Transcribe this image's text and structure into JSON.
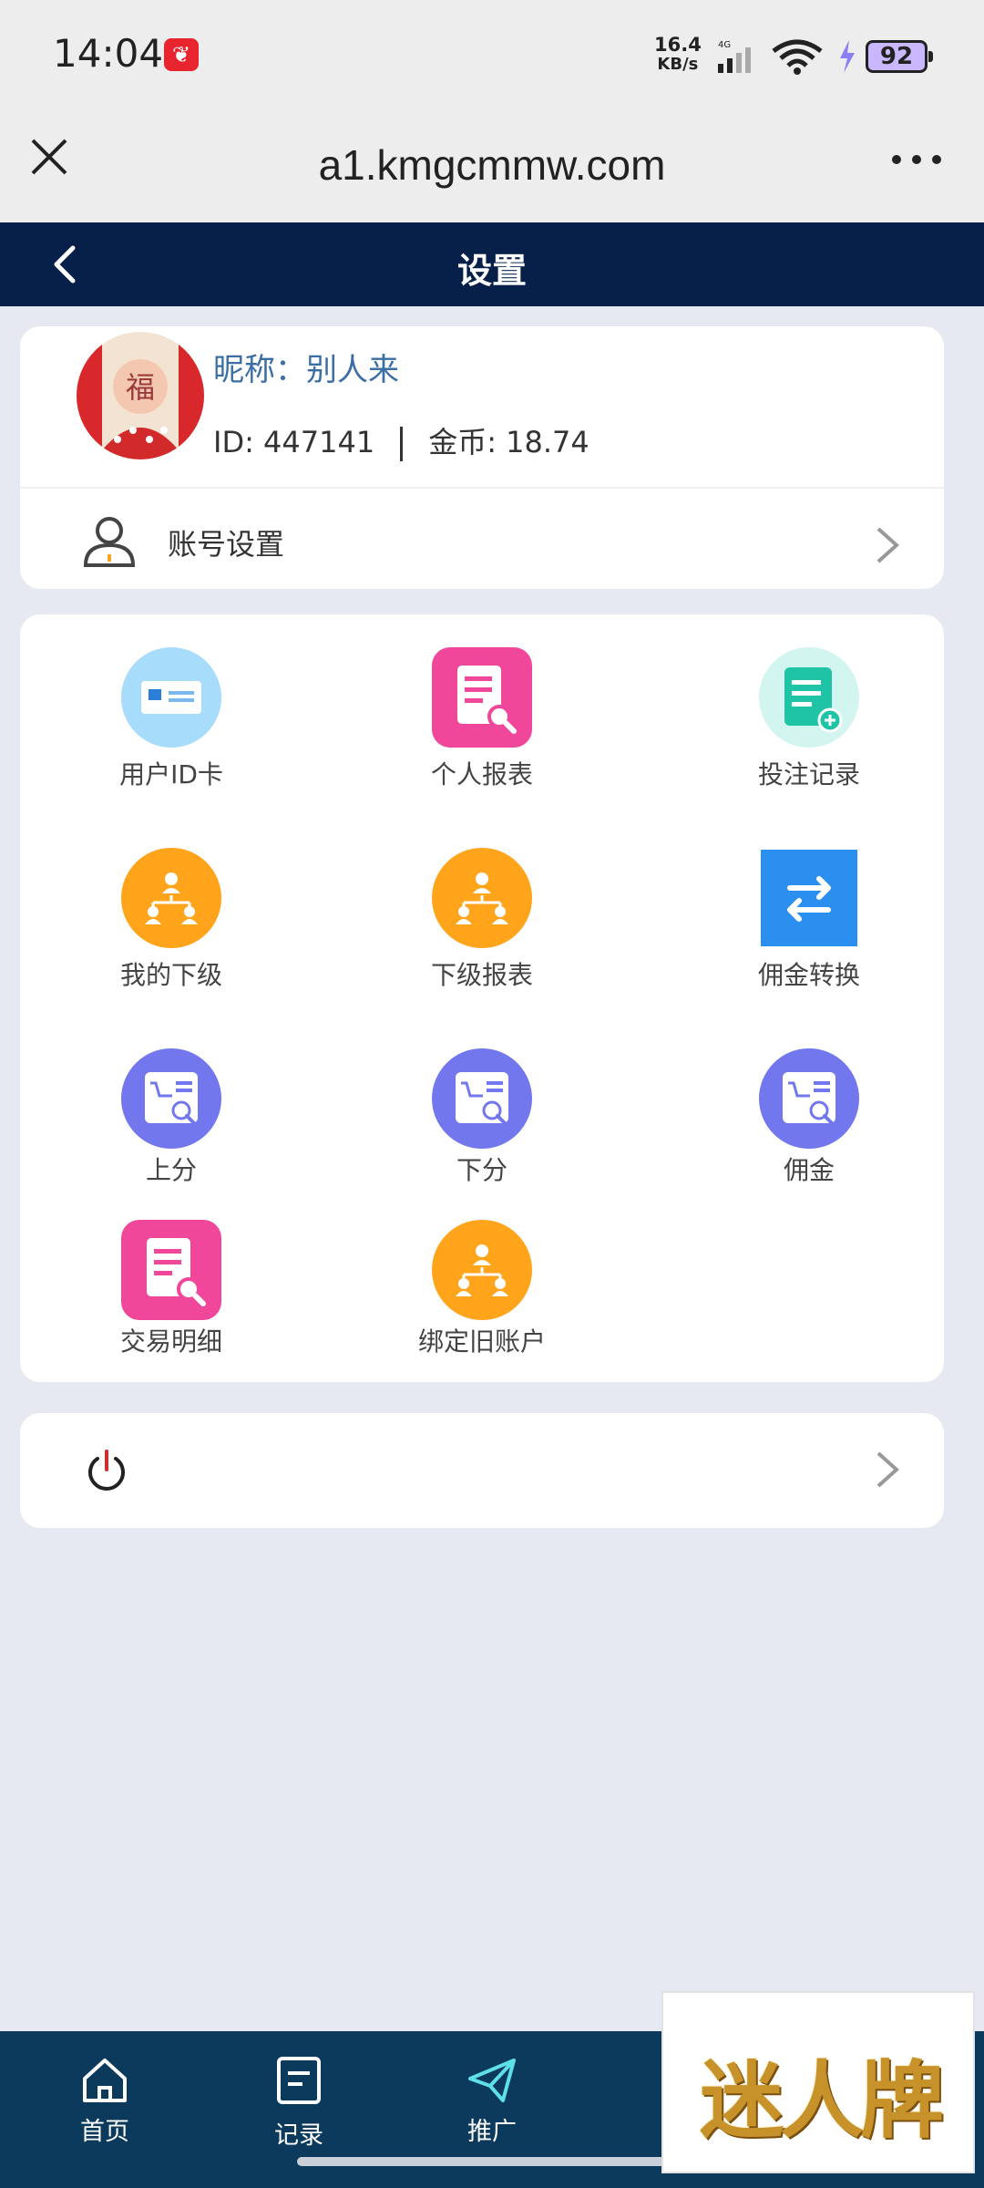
{
  "status_bar": {
    "time": "14:04",
    "net_speed_value": "16.4",
    "net_speed_unit": "KB/s",
    "network_type": "4G",
    "battery": "92"
  },
  "browser": {
    "url": "a1.kmgcmmw.com"
  },
  "header": {
    "title": "设置"
  },
  "profile": {
    "nickname": "昵称：别人来",
    "id": "ID: 447141",
    "coins": "金币: 18.74",
    "avatar_text": "福",
    "account_settings_label": "账号设置"
  },
  "grid": {
    "items": [
      {
        "label": "用户ID卡",
        "icon": "id-card-icon",
        "color": "#a8dcfb"
      },
      {
        "label": "个人报表",
        "icon": "report-search-icon",
        "color": "#f0479b"
      },
      {
        "label": "投注记录",
        "icon": "bet-record-icon",
        "color": "#d2f5ef"
      },
      {
        "label": "我的下级",
        "icon": "org-chart-icon",
        "color": "#ffa41b"
      },
      {
        "label": "下级报表",
        "icon": "org-chart-icon",
        "color": "#ffa41b"
      },
      {
        "label": "佣金转换",
        "icon": "exchange-icon",
        "color": "#2b8ff0"
      },
      {
        "label": "上分",
        "icon": "cart-search-icon",
        "color": "#7277ee"
      },
      {
        "label": "下分",
        "icon": "cart-search-icon",
        "color": "#7277ee"
      },
      {
        "label": "佣金",
        "icon": "cart-search-icon",
        "color": "#7277ee"
      },
      {
        "label": "交易明细",
        "icon": "report-search-icon",
        "color": "#f0479b"
      },
      {
        "label": "绑定旧账户",
        "icon": "org-chart-icon",
        "color": "#ffa41b"
      }
    ]
  },
  "nav": {
    "items": [
      {
        "label": "首页",
        "icon": "home-icon"
      },
      {
        "label": "记录",
        "icon": "record-icon"
      },
      {
        "label": "推广",
        "icon": "paper-plane-icon"
      }
    ]
  },
  "brand": {
    "text": "迷人牌"
  }
}
